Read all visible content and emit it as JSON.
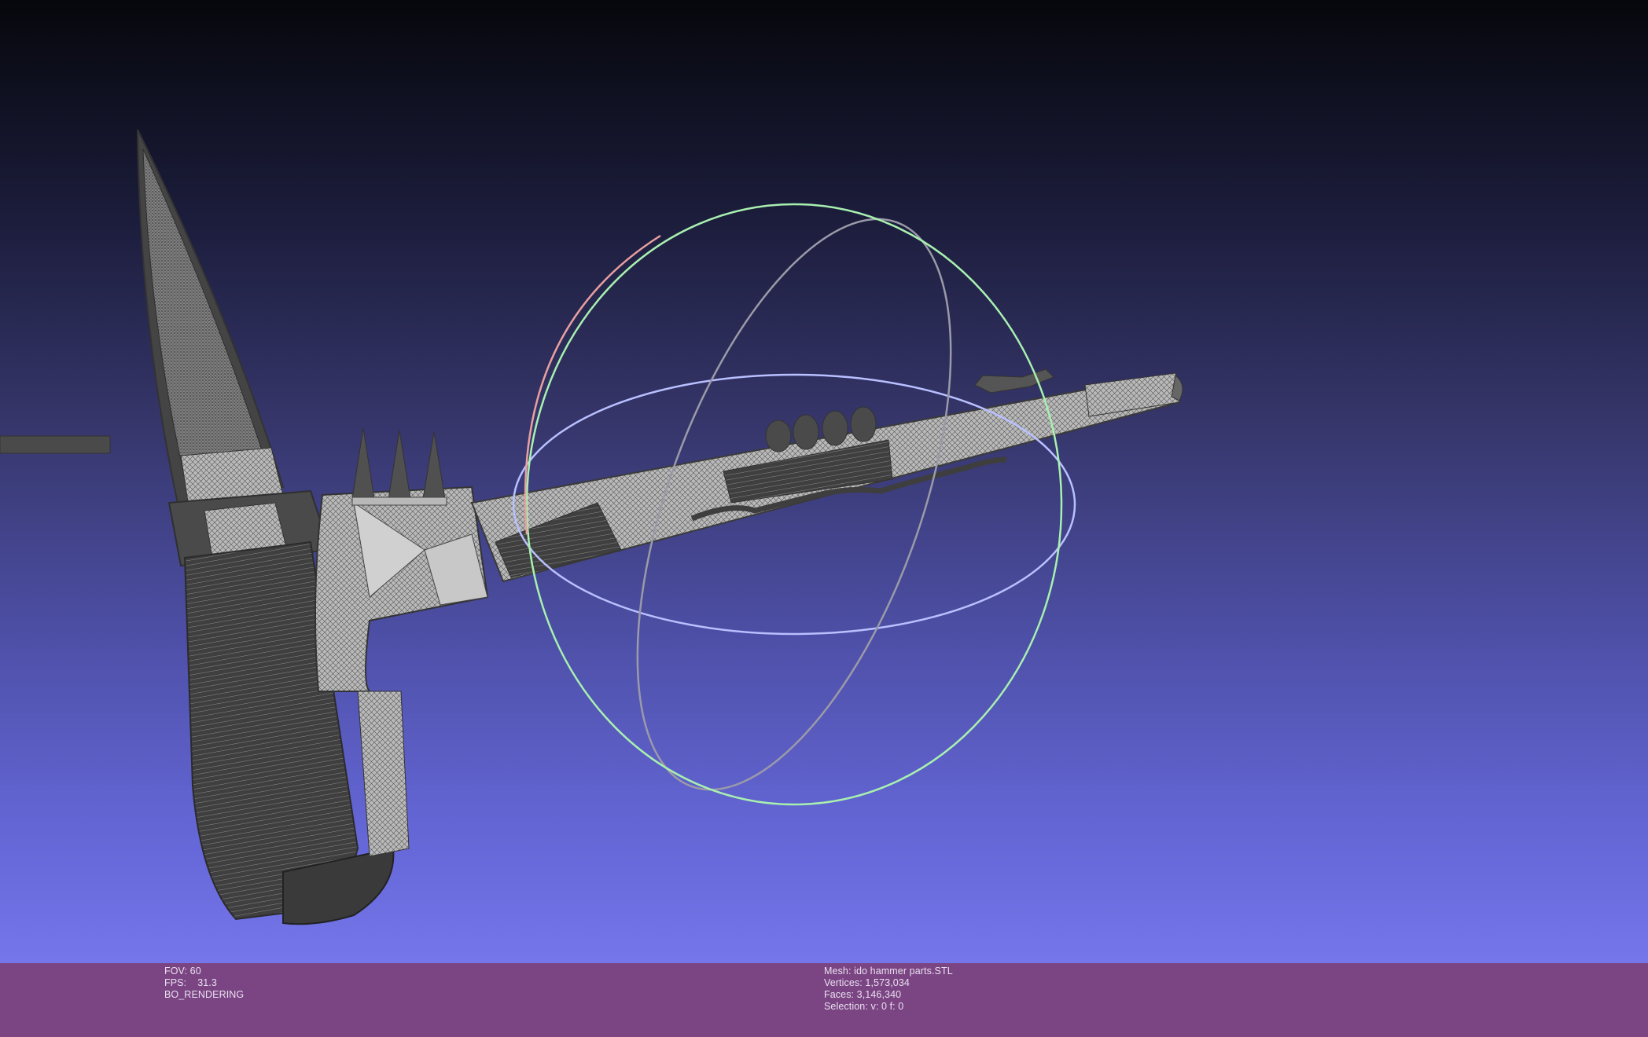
{
  "viewer": {
    "background_top": "#06070c",
    "background_bottom": "#7476ea",
    "status_bar_color": "#7b4584",
    "mesh_color": "#4a4a4a",
    "mesh_face_color": "#bdbdbd"
  },
  "status": {
    "left": {
      "fov": "FOV: 60",
      "fps_label": "FPS:",
      "fps_value": "31.3",
      "mode": "BO_RENDERING"
    },
    "right": {
      "mesh": "Mesh: ido hammer parts.STL",
      "vertices": "Vertices: 1,573,034",
      "faces": "Faces: 3,146,340",
      "selection": "Selection: v: 0 f: 0"
    }
  },
  "trackball": {
    "icon": "trackball-gizmo-icon",
    "colors": {
      "x_ring": "#e8a0a0",
      "y_ring": "#a8f0b0",
      "z_ring": "#b8c0ff",
      "neutral": "#9a9aa8"
    }
  }
}
